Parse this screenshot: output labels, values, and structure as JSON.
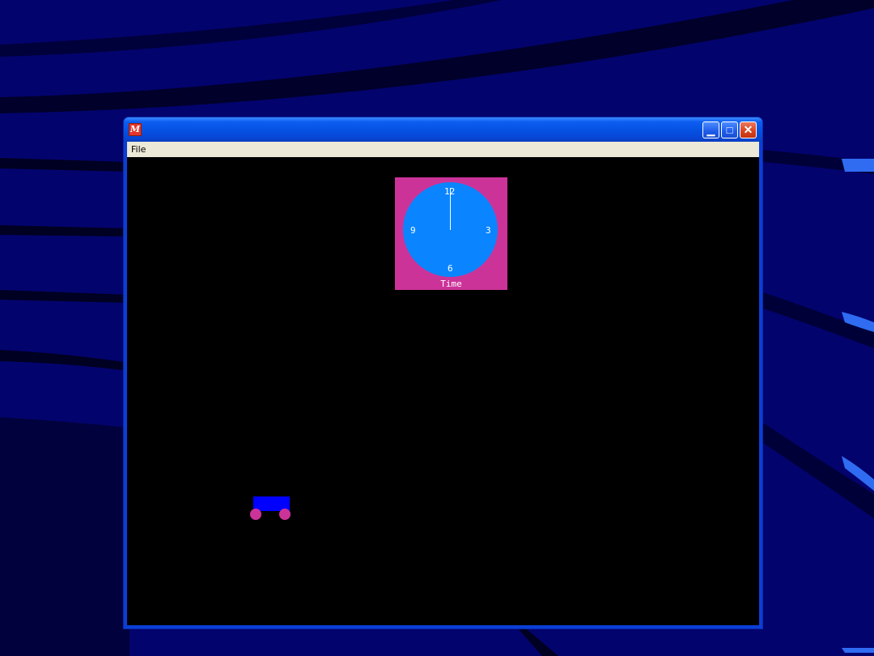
{
  "window": {
    "title": "",
    "app_icon": "M",
    "controls": {
      "minimize_icon": "minimize-icon",
      "maximize_icon": "maximize-icon",
      "close_icon": "close-icon",
      "minimize_glyph": "▁",
      "maximize_glyph": "□",
      "close_glyph": "✕"
    }
  },
  "menu": {
    "items": [
      {
        "label": "File"
      }
    ]
  },
  "clock": {
    "numbers": {
      "n12": "12",
      "n3": "3",
      "n6": "6",
      "n9": "9"
    },
    "label": "Time",
    "hand_hour": 12,
    "colors": {
      "panel": "#cc3399",
      "face": "#0a85ff",
      "hand": "#ffffff"
    }
  },
  "cart": {
    "colors": {
      "body": "#0000ff",
      "wheels": "#cc3399"
    }
  },
  "colors": {
    "desktop": "#03036e",
    "titlebar": "#0551e2",
    "menubar": "#ece9d8",
    "canvas": "#000000"
  }
}
